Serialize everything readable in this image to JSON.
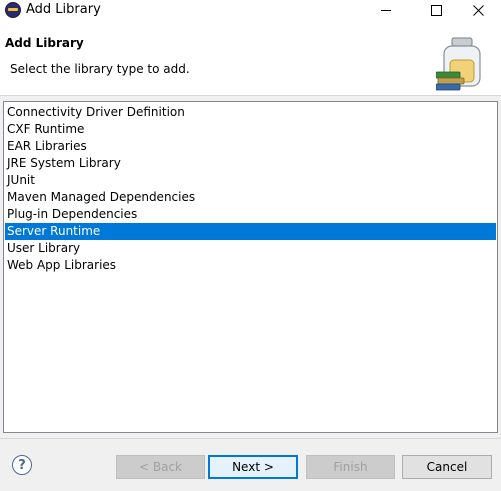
{
  "window": {
    "title": "Add Library",
    "minimize_icon": "minimize-icon",
    "maximize_icon": "maximize-icon",
    "close_icon": "close-icon"
  },
  "header": {
    "title": "Add Library",
    "description": "Select the library type to add.",
    "icon": "library-jar-books-icon"
  },
  "library_types": [
    {
      "label": "Connectivity Driver Definition",
      "selected": false
    },
    {
      "label": "CXF Runtime",
      "selected": false
    },
    {
      "label": "EAR Libraries",
      "selected": false
    },
    {
      "label": "JRE System Library",
      "selected": false
    },
    {
      "label": "JUnit",
      "selected": false
    },
    {
      "label": "Maven Managed Dependencies",
      "selected": false
    },
    {
      "label": "Plug-in Dependencies",
      "selected": false
    },
    {
      "label": "Server Runtime",
      "selected": true
    },
    {
      "label": "User Library",
      "selected": false
    },
    {
      "label": "Web App Libraries",
      "selected": false
    }
  ],
  "footer": {
    "help_label": "?",
    "back_label": "< Back",
    "next_label": "Next >",
    "finish_label": "Finish",
    "cancel_label": "Cancel"
  },
  "colors": {
    "selection": "#0078d7",
    "selection_text": "#ffffff",
    "dialog_bg": "#f0f0f0"
  }
}
